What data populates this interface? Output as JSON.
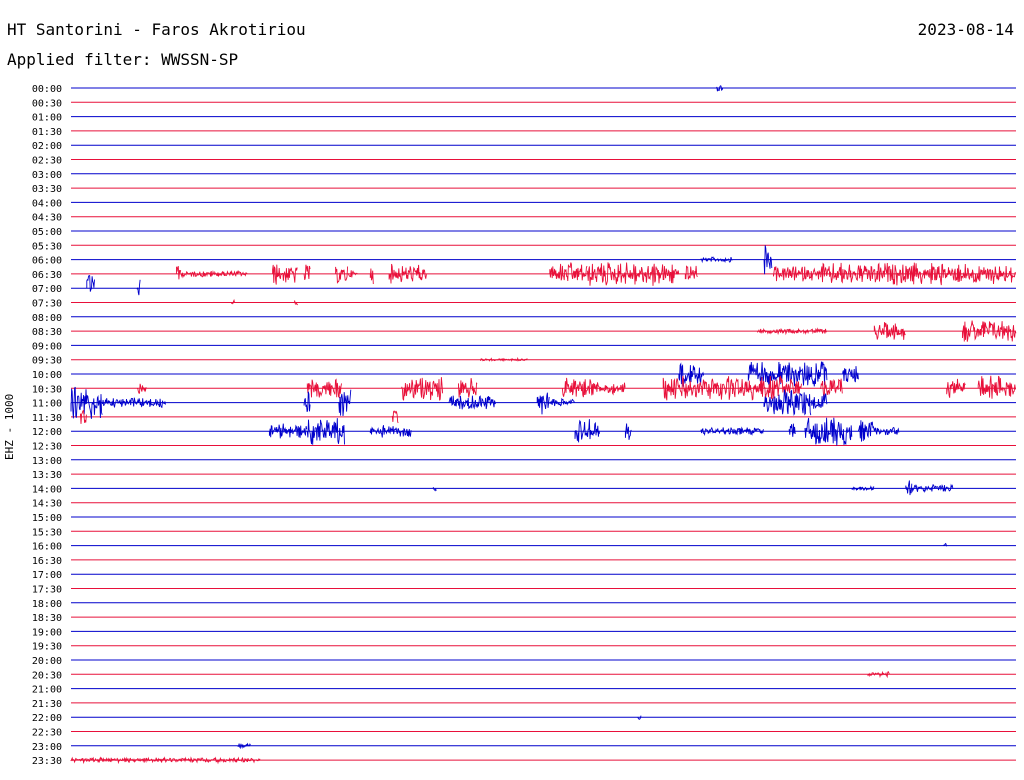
{
  "header": {
    "station": "HT Santorini - Faros Akrotiriou",
    "date": "2023-08-14",
    "filter": "Applied filter: WWSSN-SP"
  },
  "channel_label": "EHZ - 1000",
  "colors": {
    "even_trace": "#0000cc",
    "odd_trace": "#e8103a"
  },
  "chart_data": {
    "type": "line",
    "title": "HT Santorini - Faros Akrotiriou",
    "subtitle": "Applied filter: WWSSN-SP",
    "ylabel": "EHZ - 1000",
    "xlim": [
      0,
      30
    ],
    "y_categories": [
      "00:00",
      "00:30",
      "01:00",
      "01:30",
      "02:00",
      "02:30",
      "03:00",
      "03:30",
      "04:00",
      "04:30",
      "05:00",
      "05:30",
      "06:00",
      "06:30",
      "07:00",
      "07:30",
      "08:00",
      "08:30",
      "09:00",
      "09:30",
      "10:00",
      "10:30",
      "11:00",
      "11:30",
      "12:00",
      "12:30",
      "13:00",
      "13:30",
      "14:00",
      "14:30",
      "15:00",
      "15:30",
      "16:00",
      "16:30",
      "17:00",
      "17:30",
      "18:00",
      "18:30",
      "19:00",
      "19:30",
      "20:00",
      "20:30",
      "21:00",
      "21:30",
      "22:00",
      "22:30",
      "23:00",
      "23:30"
    ],
    "series": [
      {
        "row": 0,
        "bursts": [
          {
            "s": 20.5,
            "e": 20.7,
            "a": 0.3
          }
        ]
      },
      {
        "row": 12,
        "bursts": [
          {
            "s": 20.0,
            "e": 21.0,
            "a": 0.2
          },
          {
            "s": 22.0,
            "e": 22.25,
            "a": 1.6
          }
        ]
      },
      {
        "row": 13,
        "bursts": [
          {
            "s": 3.35,
            "e": 3.5,
            "a": 1.0
          },
          {
            "s": 3.5,
            "e": 5.6,
            "a": 0.25
          },
          {
            "s": 6.4,
            "e": 7.2,
            "a": 0.9
          },
          {
            "s": 7.4,
            "e": 7.6,
            "a": 0.8
          },
          {
            "s": 8.4,
            "e": 8.8,
            "a": 0.8
          },
          {
            "s": 8.8,
            "e": 9.1,
            "a": 0.3
          },
          {
            "s": 9.5,
            "e": 9.6,
            "a": 0.8
          },
          {
            "s": 10.1,
            "e": 11.3,
            "a": 0.8
          },
          {
            "s": 15.2,
            "e": 16.4,
            "a": 0.9
          },
          {
            "s": 16.4,
            "e": 19.3,
            "a": 1.0
          },
          {
            "s": 19.5,
            "e": 19.9,
            "a": 0.8
          },
          {
            "s": 22.3,
            "e": 23.8,
            "a": 0.6
          },
          {
            "s": 23.8,
            "e": 30.0,
            "a": 0.9
          }
        ]
      },
      {
        "row": 14,
        "bursts": [
          {
            "s": 0.5,
            "e": 0.75,
            "a": 1.3
          },
          {
            "s": 2.1,
            "e": 2.2,
            "a": 0.8
          }
        ]
      },
      {
        "row": 15,
        "bursts": [
          {
            "s": 5.1,
            "e": 5.2,
            "a": 0.2
          },
          {
            "s": 7.1,
            "e": 7.2,
            "a": 0.2
          }
        ]
      },
      {
        "row": 17,
        "bursts": [
          {
            "s": 21.8,
            "e": 24.0,
            "a": 0.2
          },
          {
            "s": 25.5,
            "e": 26.5,
            "a": 0.7
          },
          {
            "s": 28.3,
            "e": 30.0,
            "a": 1.0
          }
        ]
      },
      {
        "row": 19,
        "bursts": [
          {
            "s": 13.0,
            "e": 14.5,
            "a": 0.1
          }
        ]
      },
      {
        "row": 20,
        "bursts": [
          {
            "s": 19.3,
            "e": 20.1,
            "a": 1.0
          },
          {
            "s": 21.5,
            "e": 24.0,
            "a": 1.1
          },
          {
            "s": 24.5,
            "e": 25.0,
            "a": 0.7
          }
        ]
      },
      {
        "row": 21,
        "bursts": [
          {
            "s": 2.1,
            "e": 2.4,
            "a": 0.5
          },
          {
            "s": 7.5,
            "e": 8.6,
            "a": 0.8
          },
          {
            "s": 10.5,
            "e": 11.8,
            "a": 1.0
          },
          {
            "s": 12.3,
            "e": 12.9,
            "a": 0.8
          },
          {
            "s": 15.6,
            "e": 16.6,
            "a": 0.9
          },
          {
            "s": 16.6,
            "e": 17.6,
            "a": 0.5
          },
          {
            "s": 18.8,
            "e": 21.0,
            "a": 1.0
          },
          {
            "s": 21.0,
            "e": 23.2,
            "a": 1.0
          },
          {
            "s": 23.8,
            "e": 24.5,
            "a": 0.9
          },
          {
            "s": 27.8,
            "e": 28.4,
            "a": 0.8
          },
          {
            "s": 28.8,
            "e": 30.0,
            "a": 1.0
          }
        ]
      },
      {
        "row": 22,
        "bursts": [
          {
            "s": 0.0,
            "e": 1.0,
            "a": 1.4
          },
          {
            "s": 1.0,
            "e": 3.0,
            "a": 0.4
          },
          {
            "s": 7.4,
            "e": 7.6,
            "a": 0.9
          },
          {
            "s": 8.5,
            "e": 8.9,
            "a": 1.1
          },
          {
            "s": 12.0,
            "e": 13.5,
            "a": 0.6
          },
          {
            "s": 14.8,
            "e": 15.2,
            "a": 1.0
          },
          {
            "s": 15.2,
            "e": 16.0,
            "a": 0.3
          },
          {
            "s": 22.0,
            "e": 23.5,
            "a": 1.1
          },
          {
            "s": 23.5,
            "e": 24.0,
            "a": 0.8
          }
        ]
      },
      {
        "row": 23,
        "bursts": [
          {
            "s": 0.3,
            "e": 0.5,
            "a": 0.7
          },
          {
            "s": 10.2,
            "e": 10.4,
            "a": 0.6
          }
        ]
      },
      {
        "row": 24,
        "bursts": [
          {
            "s": 6.3,
            "e": 7.5,
            "a": 0.6
          },
          {
            "s": 7.5,
            "e": 8.7,
            "a": 1.1
          },
          {
            "s": 9.5,
            "e": 10.8,
            "a": 0.5
          },
          {
            "s": 16.0,
            "e": 16.8,
            "a": 1.0
          },
          {
            "s": 17.6,
            "e": 17.8,
            "a": 0.8
          },
          {
            "s": 20.0,
            "e": 22.0,
            "a": 0.3
          },
          {
            "s": 22.8,
            "e": 23.0,
            "a": 0.6
          },
          {
            "s": 23.3,
            "e": 24.8,
            "a": 1.2
          },
          {
            "s": 25.0,
            "e": 25.5,
            "a": 0.9
          },
          {
            "s": 25.5,
            "e": 26.3,
            "a": 0.3
          }
        ]
      },
      {
        "row": 28,
        "bursts": [
          {
            "s": 11.5,
            "e": 11.6,
            "a": 0.2
          },
          {
            "s": 24.8,
            "e": 25.5,
            "a": 0.2
          },
          {
            "s": 26.5,
            "e": 26.7,
            "a": 0.9
          },
          {
            "s": 26.7,
            "e": 28.0,
            "a": 0.3
          }
        ]
      },
      {
        "row": 32,
        "bursts": [
          {
            "s": 27.7,
            "e": 27.8,
            "a": 0.2
          }
        ]
      },
      {
        "row": 41,
        "bursts": [
          {
            "s": 25.3,
            "e": 26.0,
            "a": 0.2
          }
        ]
      },
      {
        "row": 44,
        "bursts": [
          {
            "s": 18.0,
            "e": 18.1,
            "a": 0.2
          }
        ]
      },
      {
        "row": 46,
        "bursts": [
          {
            "s": 5.3,
            "e": 5.7,
            "a": 0.2
          }
        ]
      },
      {
        "row": 47,
        "bursts": [
          {
            "s": 0.0,
            "e": 6.0,
            "a": 0.2
          }
        ]
      }
    ]
  }
}
